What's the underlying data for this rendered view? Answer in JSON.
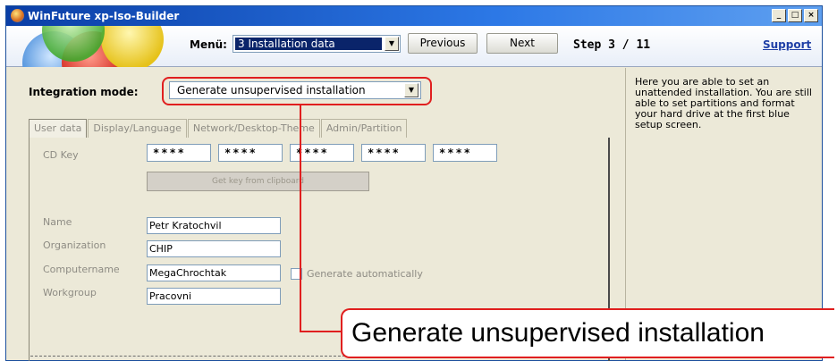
{
  "window": {
    "title": "WinFuture xp-Iso-Builder",
    "controls": [
      "_",
      "□",
      "×"
    ]
  },
  "toolbar": {
    "menu_label": "Menü:",
    "menu_selected": "3 Installation data",
    "previous_label": "Previous",
    "next_label": "Next",
    "step_text": "Step 3 / 11",
    "support_label": "Support"
  },
  "integration": {
    "label": "Integration mode:",
    "selected": "Generate unsupervised installation"
  },
  "tabs": [
    "User data",
    "Display/Language",
    "Network/Desktop-Theme",
    "Admin/Partition"
  ],
  "user_data": {
    "cd_key_label": "CD Key",
    "cd_key_parts": [
      "****",
      "****",
      "****",
      "****",
      "****"
    ],
    "clipboard_button": "Get key from clipboard",
    "name_label": "Name",
    "name_value": "Petr Kratochvil",
    "organization_label": "Organization",
    "organization_value": "CHIP",
    "computername_label": "Computername",
    "computername_value": "MegaChrochtak",
    "generate_auto_label": "Generate automatically",
    "workgroup_label": "Workgroup",
    "workgroup_value": "Pracovni"
  },
  "help_text": "Here you are able to set an unattended installation. You are still able to set partitions and format your hard drive at the first blue setup screen.",
  "callout_text": "Generate unsupervised installation",
  "colors": {
    "accent_red": "#e01f1f",
    "title_blue": "#0a3ea6"
  }
}
